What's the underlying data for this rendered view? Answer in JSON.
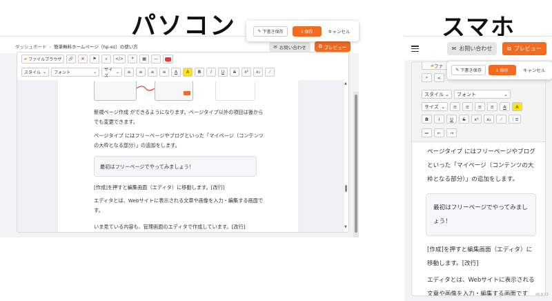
{
  "titles": {
    "pc": "パソコン",
    "sp": "スマホ"
  },
  "pc": {
    "breadcrumb": {
      "home": "ダッシュボード",
      "current": "簡単無料ホームページ（hp-ez）の使い方"
    },
    "contact_label": "お問い合わせ",
    "preview_label": "プレビュー",
    "toolbar1": {
      "file_browser": "ファイルブラウザ",
      "code": "</>",
      "quote": "❝"
    },
    "toolbar2": {
      "style": "スタイル",
      "font": "フォント",
      "size": "サイズ",
      "bold": "B",
      "italic": "I",
      "underline": "U",
      "strike": "S",
      "sup": "x²",
      "sub": "x₂"
    },
    "popup": {
      "draft": "下書き保存",
      "save": "保存",
      "cancel": "キャンセル"
    },
    "content": {
      "p1": "新規ページ作成 ができるようになります。ページタイプ以外の項目は後からでも変更できます。",
      "p2": "ページタイプ にはフリーページやブログといった「マイページ（コンテンツの大枠となる部分）」の追加をします。",
      "box": "最初はフリーページでやってみましょう！",
      "p3": "[作成]を押すと編集画面（エディタ）に移動します。[改行]",
      "p4": "エディタとは、Webサイトに表示される文章や画像を入力・編集する画面です。",
      "p5": "いま見ている内容も、管理画面のエディタで作成しています。[改行]"
    }
  },
  "sp": {
    "contact_label": "お問い合わせ",
    "preview_label": "プレビュー",
    "toolbar": {
      "file_browser": "ファ",
      "style": "スタイル",
      "font": "フォント",
      "size": "サイズ",
      "bold": "B",
      "italic": "I",
      "underline": "U",
      "strike": "S",
      "sup": "x²",
      "sub": "x₂",
      "indent_left": "←",
      "indent_right": "→"
    },
    "popup": {
      "draft": "下書き保存",
      "save": "保存",
      "cancel": "キャンセル"
    },
    "content": {
      "p1": "ページタイプ にはフリーページやブログといった「マイページ（コンテンツの大枠となる部分）」の追加をします。",
      "box": "最初はフリーページでやってみましょう！",
      "p2": "[作成]を押すと編集画面（エディタ）に移動します。[改行]",
      "p3": "エディタとは、Webサイトに表示される文章や画像を入力・編集する画面です"
    },
    "version": "v6.9.13"
  },
  "colors": {
    "accent": "#f26b21",
    "highlight": "#ffe600"
  }
}
